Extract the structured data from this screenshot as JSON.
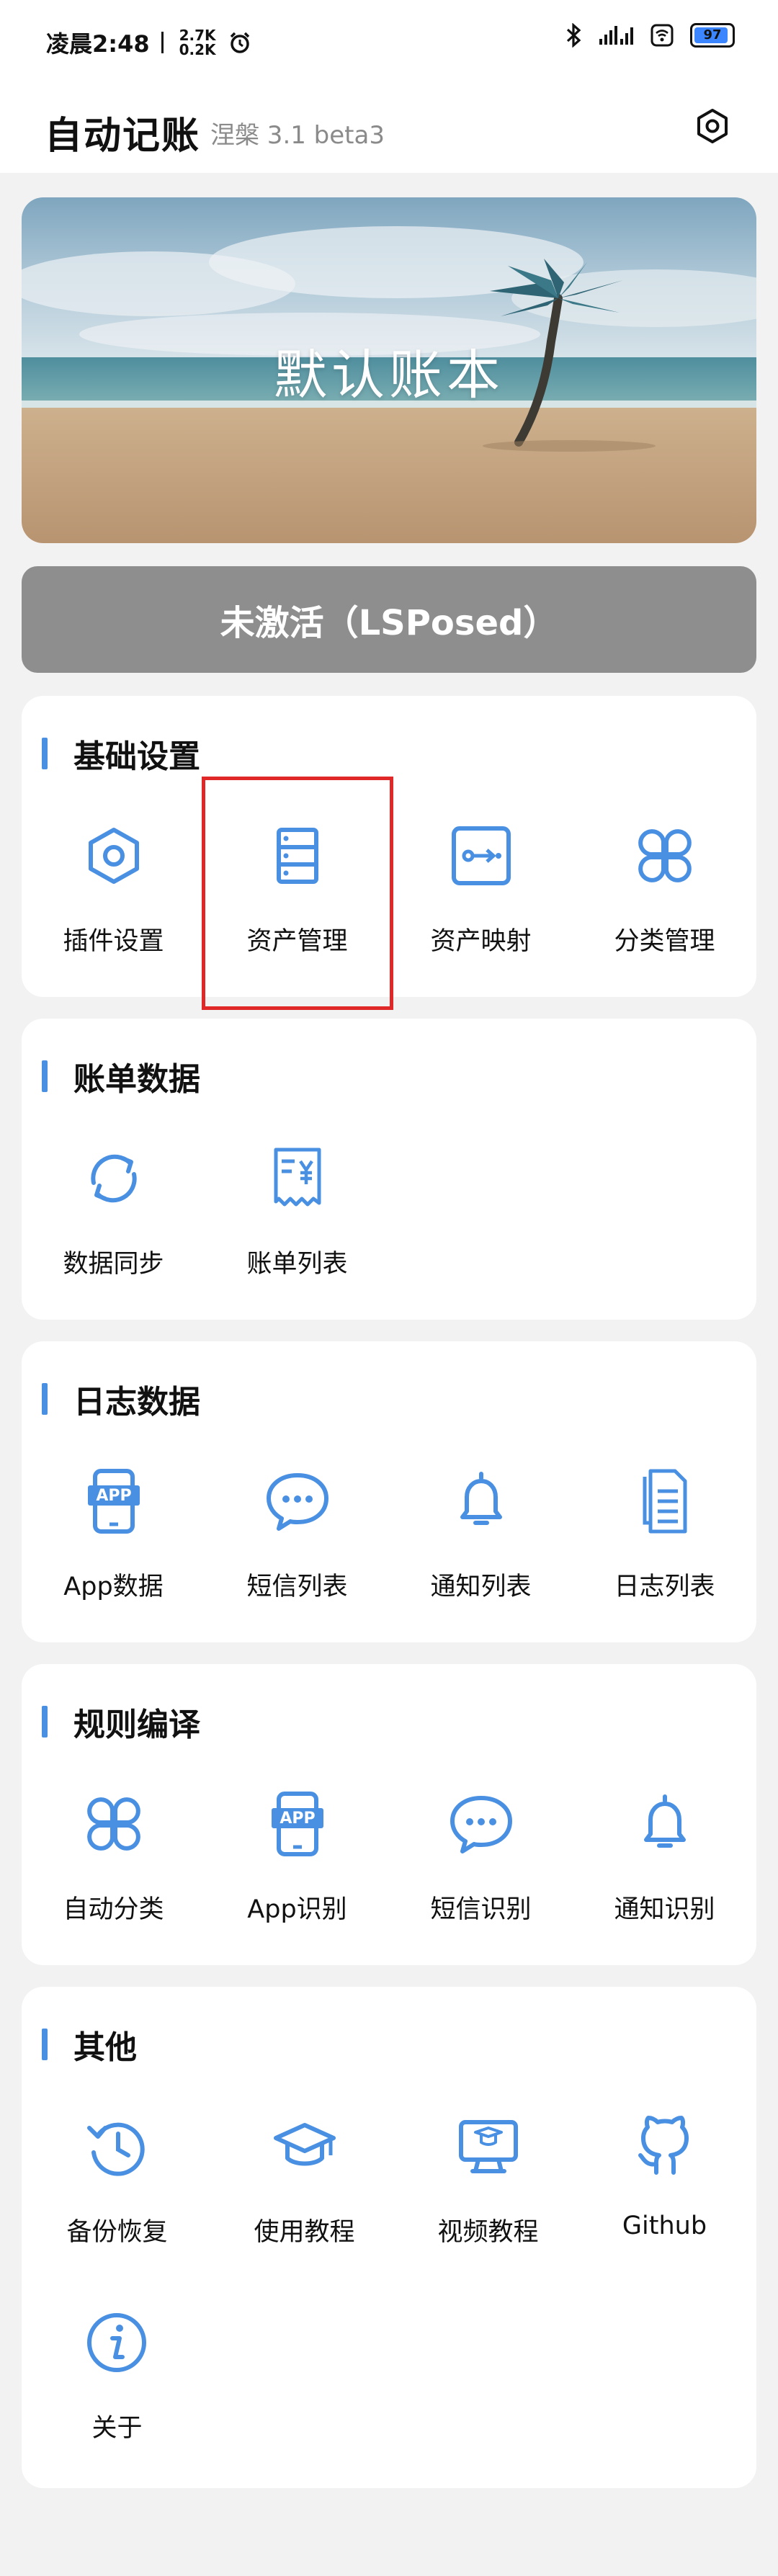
{
  "status_bar": {
    "time": "凌晨2:48",
    "net_up": "2.7K",
    "net_down": "0.2K",
    "battery": "97"
  },
  "header": {
    "title": "自动记账",
    "subtitle": "涅槃 3.1 beta3"
  },
  "banner": {
    "title": "默认账本"
  },
  "activation": {
    "label": "未激活（LSPosed）"
  },
  "sections": [
    {
      "title": "基础设置",
      "items": [
        {
          "label": "插件设置",
          "icon": "hexagon-settings-icon"
        },
        {
          "label": "资产管理",
          "icon": "server-stack-icon"
        },
        {
          "label": "资产映射",
          "icon": "mapping-arrow-icon"
        },
        {
          "label": "分类管理",
          "icon": "clover-icon"
        }
      ]
    },
    {
      "title": "账单数据",
      "items": [
        {
          "label": "数据同步",
          "icon": "sync-icon"
        },
        {
          "label": "账单列表",
          "icon": "receipt-yen-icon"
        }
      ]
    },
    {
      "title": "日志数据",
      "items": [
        {
          "label": "App数据",
          "icon": "app-phone-icon"
        },
        {
          "label": "短信列表",
          "icon": "chat-bubble-icon"
        },
        {
          "label": "通知列表",
          "icon": "bell-icon"
        },
        {
          "label": "日志列表",
          "icon": "documents-icon"
        }
      ]
    },
    {
      "title": "规则编译",
      "items": [
        {
          "label": "自动分类",
          "icon": "clover-icon"
        },
        {
          "label": "App识别",
          "icon": "app-phone-icon"
        },
        {
          "label": "短信识别",
          "icon": "chat-bubble-icon"
        },
        {
          "label": "通知识别",
          "icon": "bell-icon"
        }
      ]
    },
    {
      "title": "其他",
      "items": [
        {
          "label": "备份恢复",
          "icon": "history-icon"
        },
        {
          "label": "使用教程",
          "icon": "graduation-cap-icon"
        },
        {
          "label": "视频教程",
          "icon": "video-monitor-icon"
        },
        {
          "label": "Github",
          "icon": "github-icon"
        },
        {
          "label": "关于",
          "icon": "info-icon"
        }
      ]
    }
  ],
  "colors": {
    "accent": "#4a90e2",
    "activation_bg": "#8e8e8e",
    "highlight": "#e02828"
  }
}
